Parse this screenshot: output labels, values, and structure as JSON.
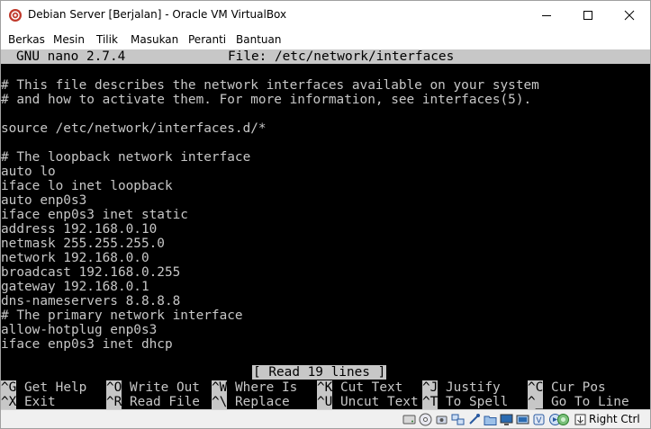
{
  "window": {
    "title": "Debian Server [Berjalan] - Oracle VM VirtualBox"
  },
  "menu": [
    "Berkas",
    "Mesin",
    "Tilik",
    "Masukan",
    "Peranti",
    "Bantuan"
  ],
  "nano": {
    "version": "GNU nano 2.7.4",
    "file_label": "File: /etc/network/interfaces",
    "lines": [
      "",
      "# This file describes the network interfaces available on your system",
      "# and how to activate them. For more information, see interfaces(5).",
      "",
      "source /etc/network/interfaces.d/*",
      "",
      "# The loopback network interface",
      "auto lo",
      "iface lo inet loopback",
      "auto enp0s3",
      "iface enp0s3 inet static",
      "address 192.168.0.10",
      "netmask 255.255.255.0",
      "network 192.168.0.0",
      "broadcast 192.168.0.255",
      "gateway 192.168.0.1",
      "dns-nameservers 8.8.8.8",
      "# The primary network interface",
      "allow-hotplug enp0s3",
      "iface enp0s3 inet dhcp"
    ],
    "status_message": "[ Read 19 lines ]",
    "shortcuts_row1": [
      {
        "key": "^G",
        "label": "Get Help"
      },
      {
        "key": "^O",
        "label": "Write Out"
      },
      {
        "key": "^W",
        "label": "Where Is"
      },
      {
        "key": "^K",
        "label": "Cut Text"
      },
      {
        "key": "^J",
        "label": "Justify"
      },
      {
        "key": "^C",
        "label": "Cur Pos"
      }
    ],
    "shortcuts_row2": [
      {
        "key": "^X",
        "label": "Exit"
      },
      {
        "key": "^R",
        "label": "Read File"
      },
      {
        "key": "^\\",
        "label": "Replace"
      },
      {
        "key": "^U",
        "label": "Uncut Text"
      },
      {
        "key": "^T",
        "label": "To Spell"
      },
      {
        "key": "^_",
        "label": "Go To Line"
      }
    ]
  },
  "statusbar": {
    "icons": [
      "hard-disk-icon",
      "optical-drive-icon",
      "audio-icon",
      "network-icon",
      "usb-icon",
      "shared-folder-icon",
      "display-icon",
      "video-capture-icon",
      "mouse-integration-icon",
      "cpu-icon",
      "keyboard-icon"
    ],
    "host_key": "Right Ctrl"
  },
  "colors": {
    "terminal_bg": "#000000",
    "terminal_fg": "#c7c7c7",
    "inverse_bg": "#c7c7c7"
  }
}
